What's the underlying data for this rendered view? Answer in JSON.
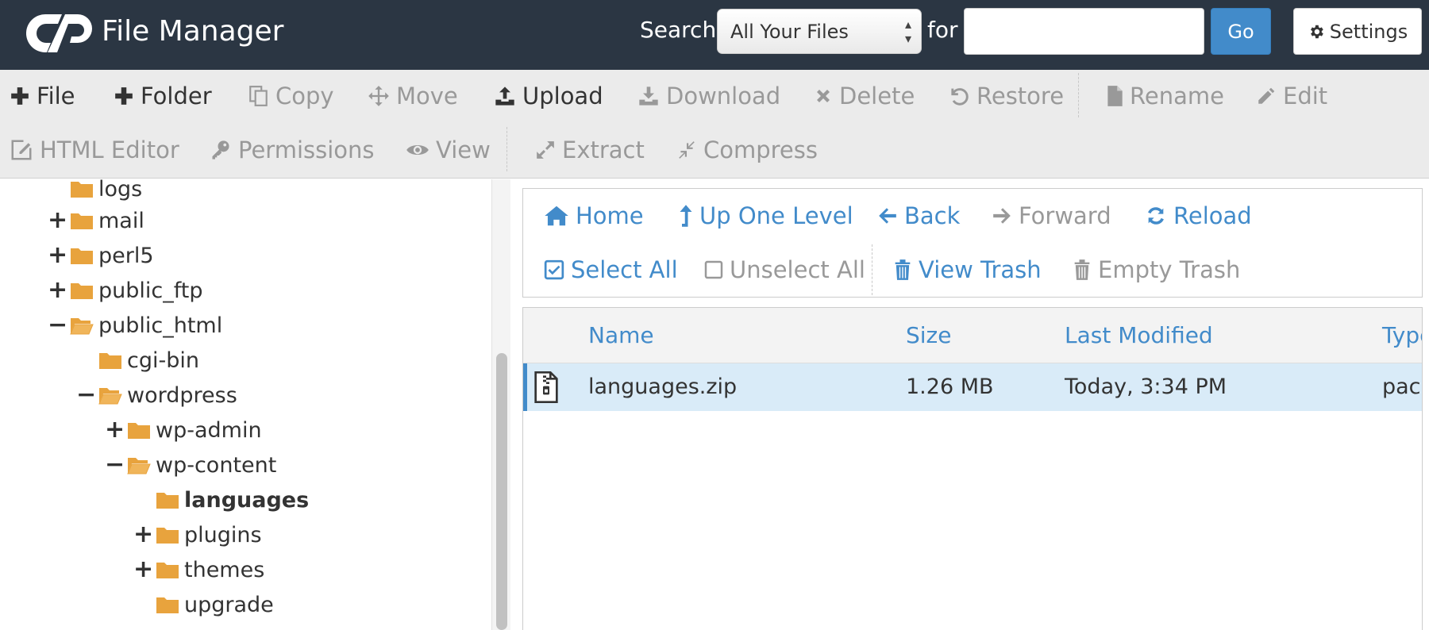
{
  "header": {
    "app_title": "File Manager",
    "search_label": "Search",
    "search_scope": "All Your Files",
    "for_label": "for",
    "search_value": "",
    "go_label": "Go",
    "settings_label": "Settings"
  },
  "toolbar": {
    "file": "File",
    "folder": "Folder",
    "copy": "Copy",
    "move": "Move",
    "upload": "Upload",
    "download": "Download",
    "delete": "Delete",
    "restore": "Restore",
    "rename": "Rename",
    "edit": "Edit",
    "html_editor": "HTML Editor",
    "permissions": "Permissions",
    "view": "View",
    "extract": "Extract",
    "compress": "Compress"
  },
  "tree": {
    "items": [
      {
        "label": "logs",
        "toggle": ""
      },
      {
        "label": "mail",
        "toggle": "+"
      },
      {
        "label": "perl5",
        "toggle": "+"
      },
      {
        "label": "public_ftp",
        "toggle": "+"
      },
      {
        "label": "public_html",
        "toggle": "−"
      },
      {
        "label": "cgi-bin",
        "toggle": ""
      },
      {
        "label": "wordpress",
        "toggle": "−"
      },
      {
        "label": "wp-admin",
        "toggle": "+"
      },
      {
        "label": "wp-content",
        "toggle": "−"
      },
      {
        "label": "languages",
        "toggle": ""
      },
      {
        "label": "plugins",
        "toggle": "+"
      },
      {
        "label": "themes",
        "toggle": "+"
      },
      {
        "label": "upgrade",
        "toggle": ""
      }
    ]
  },
  "nav": {
    "home": "Home",
    "up_one_level": "Up One Level",
    "back": "Back",
    "forward": "Forward",
    "reload": "Reload",
    "select_all": "Select All",
    "unselect_all": "Unselect All",
    "view_trash": "View Trash",
    "empty_trash": "Empty Trash"
  },
  "file_table": {
    "columns": {
      "name": "Name",
      "size": "Size",
      "modified": "Last Modified",
      "type": "Type"
    },
    "rows": [
      {
        "name": "languages.zip",
        "size": "1.26 MB",
        "modified": "Today, 3:34 PM",
        "type": "package/x-generic"
      }
    ]
  },
  "colors": {
    "header_bg": "#2b3643",
    "accent": "#428bca",
    "selected_row": "#d9ebf8",
    "folder": "#e8a33d"
  }
}
